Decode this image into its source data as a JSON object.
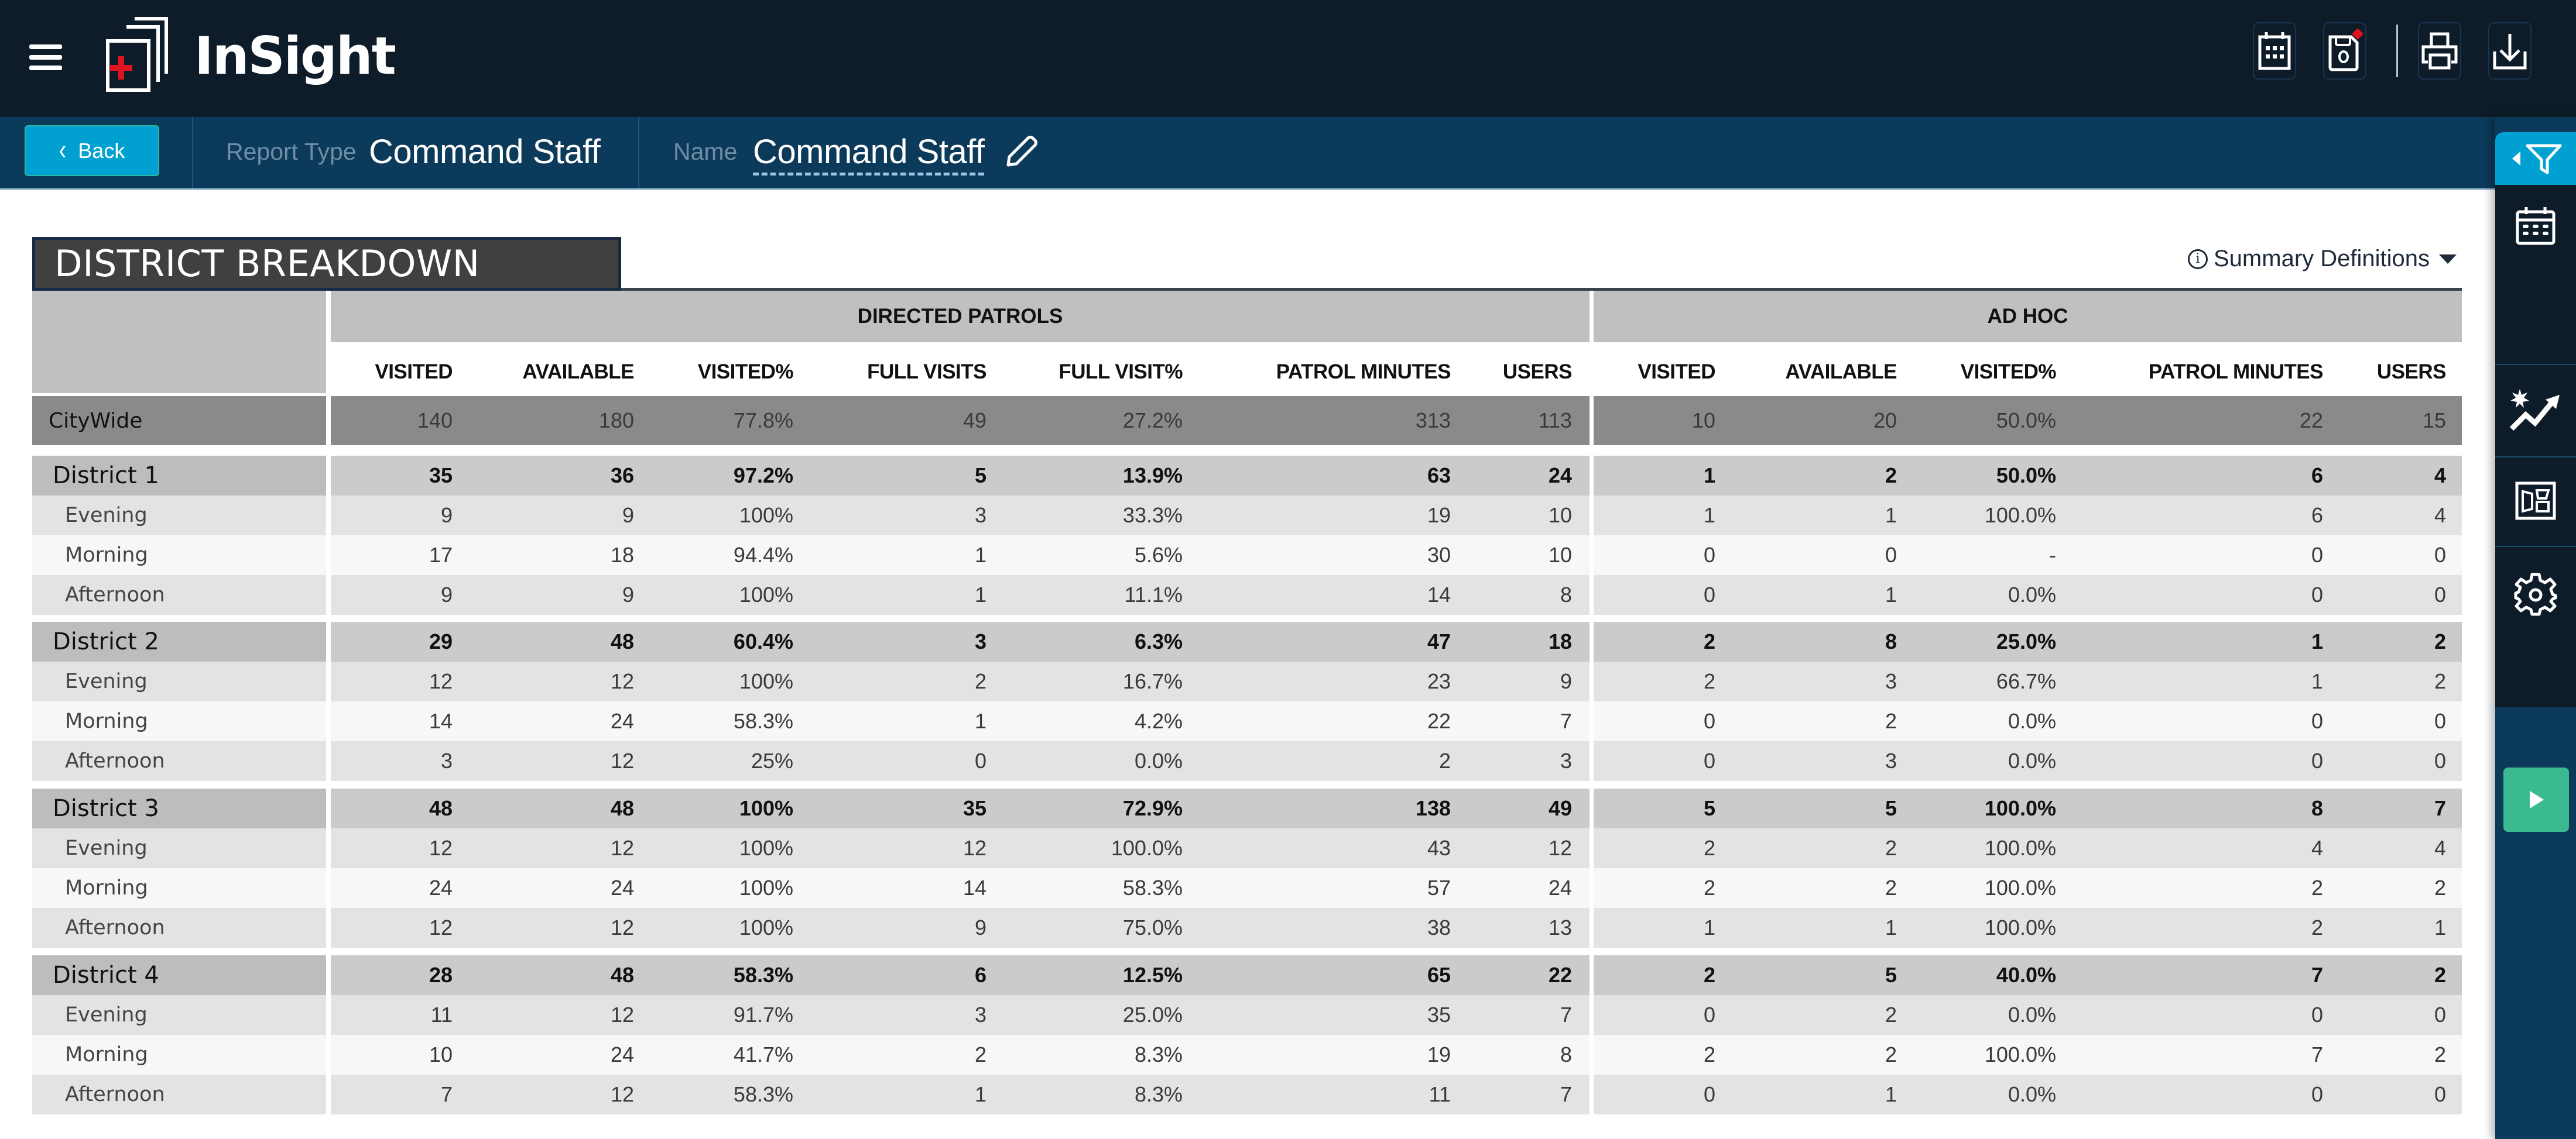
{
  "app": {
    "title": "InSight",
    "menu_icon": "hamburger-menu-icon",
    "toolbar": [
      {
        "name": "schedule",
        "icon": "calendar-icon"
      },
      {
        "name": "save",
        "icon": "save-disk-icon",
        "badge": "new"
      },
      {
        "name": "print",
        "icon": "printer-icon"
      },
      {
        "name": "download",
        "icon": "download-icon"
      }
    ]
  },
  "subheader": {
    "back_label": "Back",
    "report_type_label": "Report Type",
    "report_type_value": "Command Staff",
    "name_label": "Name",
    "name_value": "Command Staff"
  },
  "sidebar": {
    "items": [
      {
        "name": "filter",
        "icon": "filter-icon"
      },
      {
        "name": "date-range",
        "icon": "calendar-icon"
      },
      {
        "name": "trends",
        "icon": "trend-chart-icon"
      },
      {
        "name": "layout",
        "icon": "layout-icon"
      },
      {
        "name": "settings",
        "icon": "gear-icon"
      },
      {
        "name": "run",
        "icon": "play-icon"
      }
    ]
  },
  "report": {
    "section_title": "DISTRICT BREAKDOWN",
    "summary_definitions_label": "Summary Definitions",
    "groups": [
      {
        "label": "DIRECTED PATROLS",
        "columns": [
          "VISITED",
          "AVAILABLE",
          "VISITED%",
          "FULL VISITS",
          "FULL VISIT%",
          "PATROL MINUTES",
          "USERS"
        ]
      },
      {
        "label": "AD HOC",
        "columns": [
          "VISITED",
          "AVAILABLE",
          "VISITED%",
          "PATROL MINUTES",
          "USERS"
        ]
      }
    ],
    "citywide": {
      "label": "CityWide",
      "directed": [
        "140",
        "180",
        "77.8%",
        "49",
        "27.2%",
        "313",
        "113"
      ],
      "adhoc": [
        "10",
        "20",
        "50.0%",
        "22",
        "15"
      ]
    },
    "districts": [
      {
        "label": "District 1",
        "directed": [
          "35",
          "36",
          "97.2%",
          "5",
          "13.9%",
          "63",
          "24"
        ],
        "adhoc": [
          "1",
          "2",
          "50.0%",
          "6",
          "4"
        ],
        "shifts": [
          {
            "label": "Evening",
            "directed": [
              "9",
              "9",
              "100%",
              "3",
              "33.3%",
              "19",
              "10"
            ],
            "adhoc": [
              "1",
              "1",
              "100.0%",
              "6",
              "4"
            ]
          },
          {
            "label": "Morning",
            "directed": [
              "17",
              "18",
              "94.4%",
              "1",
              "5.6%",
              "30",
              "10"
            ],
            "adhoc": [
              "0",
              "0",
              "-",
              "0",
              "0"
            ]
          },
          {
            "label": "Afternoon",
            "directed": [
              "9",
              "9",
              "100%",
              "1",
              "11.1%",
              "14",
              "8"
            ],
            "adhoc": [
              "0",
              "1",
              "0.0%",
              "0",
              "0"
            ]
          }
        ]
      },
      {
        "label": "District 2",
        "directed": [
          "29",
          "48",
          "60.4%",
          "3",
          "6.3%",
          "47",
          "18"
        ],
        "adhoc": [
          "2",
          "8",
          "25.0%",
          "1",
          "2"
        ],
        "shifts": [
          {
            "label": "Evening",
            "directed": [
              "12",
              "12",
              "100%",
              "2",
              "16.7%",
              "23",
              "9"
            ],
            "adhoc": [
              "2",
              "3",
              "66.7%",
              "1",
              "2"
            ]
          },
          {
            "label": "Morning",
            "directed": [
              "14",
              "24",
              "58.3%",
              "1",
              "4.2%",
              "22",
              "7"
            ],
            "adhoc": [
              "0",
              "2",
              "0.0%",
              "0",
              "0"
            ]
          },
          {
            "label": "Afternoon",
            "directed": [
              "3",
              "12",
              "25%",
              "0",
              "0.0%",
              "2",
              "3"
            ],
            "adhoc": [
              "0",
              "3",
              "0.0%",
              "0",
              "0"
            ]
          }
        ]
      },
      {
        "label": "District 3",
        "directed": [
          "48",
          "48",
          "100%",
          "35",
          "72.9%",
          "138",
          "49"
        ],
        "adhoc": [
          "5",
          "5",
          "100.0%",
          "8",
          "7"
        ],
        "shifts": [
          {
            "label": "Evening",
            "directed": [
              "12",
              "12",
              "100%",
              "12",
              "100.0%",
              "43",
              "12"
            ],
            "adhoc": [
              "2",
              "2",
              "100.0%",
              "4",
              "4"
            ]
          },
          {
            "label": "Morning",
            "directed": [
              "24",
              "24",
              "100%",
              "14",
              "58.3%",
              "57",
              "24"
            ],
            "adhoc": [
              "2",
              "2",
              "100.0%",
              "2",
              "2"
            ]
          },
          {
            "label": "Afternoon",
            "directed": [
              "12",
              "12",
              "100%",
              "9",
              "75.0%",
              "38",
              "13"
            ],
            "adhoc": [
              "1",
              "1",
              "100.0%",
              "2",
              "1"
            ]
          }
        ]
      },
      {
        "label": "District 4",
        "directed": [
          "28",
          "48",
          "58.3%",
          "6",
          "12.5%",
          "65",
          "22"
        ],
        "adhoc": [
          "2",
          "5",
          "40.0%",
          "7",
          "2"
        ],
        "shifts": [
          {
            "label": "Evening",
            "directed": [
              "11",
              "12",
              "91.7%",
              "3",
              "25.0%",
              "35",
              "7"
            ],
            "adhoc": [
              "0",
              "2",
              "0.0%",
              "0",
              "0"
            ]
          },
          {
            "label": "Morning",
            "directed": [
              "10",
              "24",
              "41.7%",
              "2",
              "8.3%",
              "19",
              "8"
            ],
            "adhoc": [
              "2",
              "2",
              "100.0%",
              "7",
              "2"
            ]
          },
          {
            "label": "Afternoon",
            "directed": [
              "7",
              "12",
              "58.3%",
              "1",
              "8.3%",
              "11",
              "7"
            ],
            "adhoc": [
              "0",
              "1",
              "0.0%",
              "0",
              "0"
            ]
          }
        ]
      }
    ]
  },
  "colors": {
    "topbar": "#0e1c2a",
    "subbar": "#0c3a5a",
    "accent": "#00a0d0",
    "run": "#3bb98f",
    "badge": "#e0141e",
    "logo_cross": "#e0141e"
  }
}
